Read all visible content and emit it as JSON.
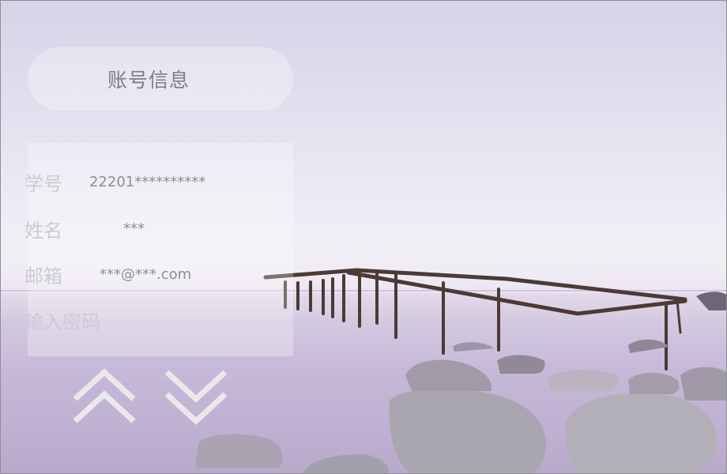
{
  "header": {
    "title": "账号信息"
  },
  "account_info": {
    "rows": [
      {
        "label": "学号",
        "value": "22201**********"
      },
      {
        "label": "姓名",
        "value": "***"
      },
      {
        "label": "邮箱",
        "value": "***@***.com"
      }
    ],
    "password": {
      "placeholder": "输入密码",
      "value": ""
    }
  },
  "nav": {
    "up_icon": "double-chevron-up-icon",
    "down_icon": "double-chevron-down-icon"
  },
  "colors": {
    "sky": "#e7e3f1",
    "sea_mist": "#c6b9d8",
    "chevron": "#e9e9ec",
    "label_text": "#cbcbd2",
    "value_text": "#8d8d95"
  }
}
